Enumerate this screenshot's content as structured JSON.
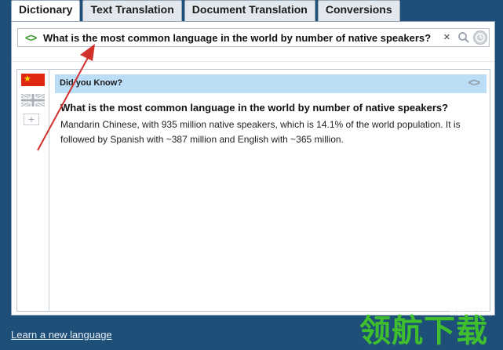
{
  "tabs": [
    {
      "label": "Dictionary",
      "active": true
    },
    {
      "label": "Text Translation",
      "active": false
    },
    {
      "label": "Document Translation",
      "active": false
    },
    {
      "label": "Conversions",
      "active": false
    }
  ],
  "search": {
    "value": "What is the most common language in the world by number of native speakers?",
    "swap_icon": "<>",
    "clear_icon": "×"
  },
  "sidebar": {
    "flags": [
      "china-flag-icon",
      "uk-flag-icon"
    ],
    "add_symbol": "+"
  },
  "did_you_know": {
    "title": "Did you Know?",
    "nav_icon": "<>",
    "question": "What is the most common language in the world by number of native speakers?",
    "answer": "Mandarin Chinese, with 935 million native speakers, which is 14.1% of the world population. It is followed by Spanish with ~387 million and English with ~365 million."
  },
  "footer": {
    "learn_link": "Learn a new language"
  },
  "watermark": {
    "site": "lhdown.com",
    "logo_text": "领航下载"
  },
  "colors": {
    "background": "#1d4f78",
    "accent_green": "#3a9a2a",
    "info_bar": "#bbddf6",
    "arrow_red": "#d0312d"
  }
}
